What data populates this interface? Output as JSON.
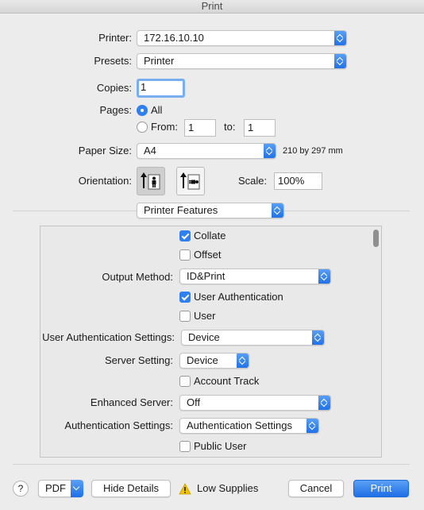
{
  "window": {
    "title": "Print"
  },
  "printer": {
    "label": "Printer:",
    "value": "172.16.10.10"
  },
  "presets": {
    "label": "Presets:",
    "value": "Printer"
  },
  "copies": {
    "label": "Copies:",
    "value": "1"
  },
  "pages": {
    "label": "Pages:",
    "all_label": "All",
    "from_label": "From:",
    "from_value": "1",
    "to_label": "to:",
    "to_value": "1",
    "selected": "All"
  },
  "paper_size": {
    "label": "Paper Size:",
    "value": "A4",
    "dimensions": "210 by 297 mm"
  },
  "orientation": {
    "label": "Orientation:",
    "selected": "portrait"
  },
  "scale": {
    "label": "Scale:",
    "value": "100%"
  },
  "section": {
    "value": "Printer Features"
  },
  "features": {
    "collate": {
      "label": "Collate",
      "checked": true
    },
    "offset": {
      "label": "Offset",
      "checked": false
    },
    "output_method": {
      "label": "Output Method:",
      "value": "ID&Print"
    },
    "user_authentication": {
      "label": "User Authentication",
      "checked": true
    },
    "user": {
      "label": "User",
      "checked": false
    },
    "user_auth_settings": {
      "label": "User Authentication Settings:",
      "value": "Device"
    },
    "server_setting": {
      "label": "Server Setting:",
      "value": "Device"
    },
    "account_track": {
      "label": "Account Track",
      "checked": false
    },
    "enhanced_server": {
      "label": "Enhanced Server:",
      "value": "Off"
    },
    "authentication_settings": {
      "label": "Authentication Settings:",
      "value": "Authentication Settings"
    },
    "public_user": {
      "label": "Public User",
      "checked": false
    }
  },
  "footer": {
    "help": "?",
    "pdf": "PDF",
    "hide_details": "Hide Details",
    "low_supplies": "Low Supplies",
    "cancel": "Cancel",
    "print": "Print"
  },
  "colors": {
    "accent": "#2f7ff0",
    "warning": "#f5c400"
  },
  "icons": [
    "portrait-orientation-icon",
    "landscape-orientation-icon",
    "warning-icon",
    "help-icon",
    "chevron-down-icon",
    "popup-stepper-icon"
  ]
}
